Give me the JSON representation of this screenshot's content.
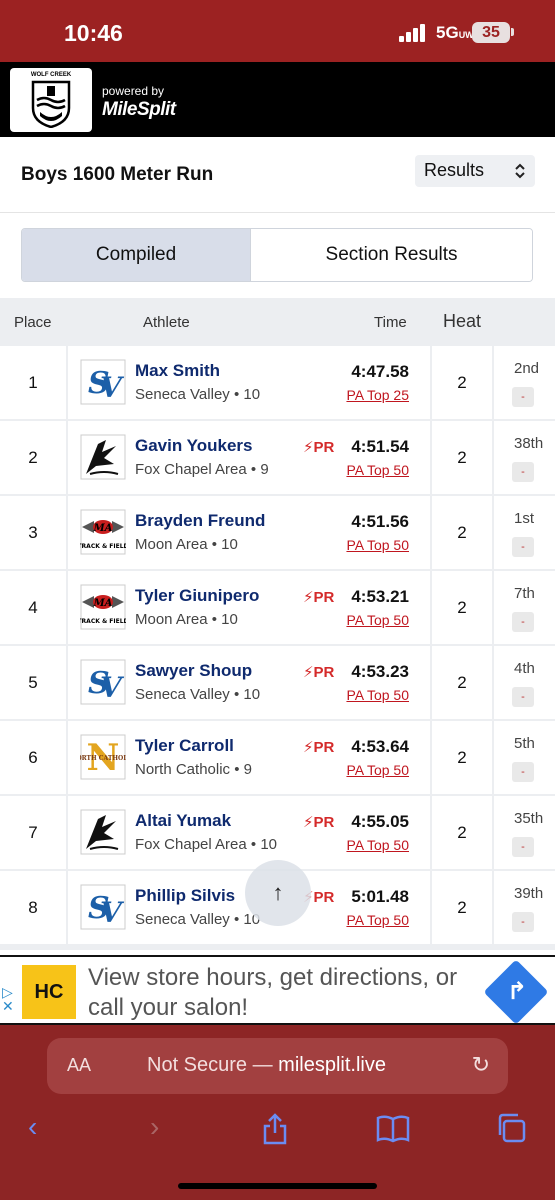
{
  "status_bar": {
    "time": "10:46",
    "network": "5G",
    "network_suffix": "UW",
    "battery": "35"
  },
  "header": {
    "logo_text": "WOLF CREEK",
    "powered_by": "powered by",
    "brand": "MileSplit"
  },
  "event": {
    "title": "Boys 1600 Meter Run",
    "view_select": "Results"
  },
  "tabs": [
    {
      "label": "Compiled",
      "active": true
    },
    {
      "label": "Section Results",
      "active": false
    }
  ],
  "table": {
    "headers": {
      "place": "Place",
      "athlete": "Athlete",
      "time": "Time",
      "heat": "Heat"
    },
    "rows": [
      {
        "place": "1",
        "name": "Max Smith",
        "team": "Seneca Valley • 10",
        "pr": "",
        "time": "4:47.58",
        "rank": "PA Top 25",
        "heat": "2",
        "section_place": "2nd",
        "dash": "-",
        "logo": "SV"
      },
      {
        "place": "2",
        "name": "Gavin Youkers",
        "team": "Fox Chapel Area • 9",
        "pr": "PR",
        "time": "4:51.54",
        "rank": "PA Top 50",
        "heat": "2",
        "section_place": "38th",
        "dash": "-",
        "logo": "FC"
      },
      {
        "place": "3",
        "name": "Brayden Freund",
        "team": "Moon Area • 10",
        "pr": "",
        "time": "4:51.56",
        "rank": "PA Top 50",
        "heat": "2",
        "section_place": "1st",
        "dash": "-",
        "logo": "MA"
      },
      {
        "place": "4",
        "name": "Tyler Giunipero",
        "team": "Moon Area • 10",
        "pr": "PR",
        "time": "4:53.21",
        "rank": "PA Top 50",
        "heat": "2",
        "section_place": "7th",
        "dash": "-",
        "logo": "MA"
      },
      {
        "place": "5",
        "name": "Sawyer Shoup",
        "team": "Seneca Valley • 10",
        "pr": "PR",
        "time": "4:53.23",
        "rank": "PA Top 50",
        "heat": "2",
        "section_place": "4th",
        "dash": "-",
        "logo": "SV"
      },
      {
        "place": "6",
        "name": "Tyler Carroll",
        "team": "North Catholic • 9",
        "pr": "PR",
        "time": "4:53.64",
        "rank": "PA Top 50",
        "heat": "2",
        "section_place": "5th",
        "dash": "-",
        "logo": "NC"
      },
      {
        "place": "7",
        "name": "Altai Yumak",
        "team": "Fox Chapel Area • 10",
        "pr": "PR",
        "time": "4:55.05",
        "rank": "PA Top 50",
        "heat": "2",
        "section_place": "35th",
        "dash": "-",
        "logo": "FC"
      },
      {
        "place": "8",
        "name": "Phillip Silvis",
        "team": "Seneca Valley • 10",
        "pr": "PR",
        "time": "5:01.48",
        "rank": "PA Top 50",
        "heat": "2",
        "section_place": "39th",
        "dash": "-",
        "logo": "SV"
      }
    ]
  },
  "ad": {
    "logo_text": "HC",
    "text": "View store hours, get directions, or call your salon!"
  },
  "browser": {
    "aa": "AA",
    "not_secure": "Not Secure —",
    "host": "milesplit.live"
  },
  "icons": {
    "scroll_top": "arrow-up-icon",
    "reload": "reload-icon",
    "back": "back-icon",
    "forward": "forward-icon",
    "share": "share-icon",
    "bookmarks": "bookmarks-icon",
    "tabs": "tabs-icon"
  }
}
